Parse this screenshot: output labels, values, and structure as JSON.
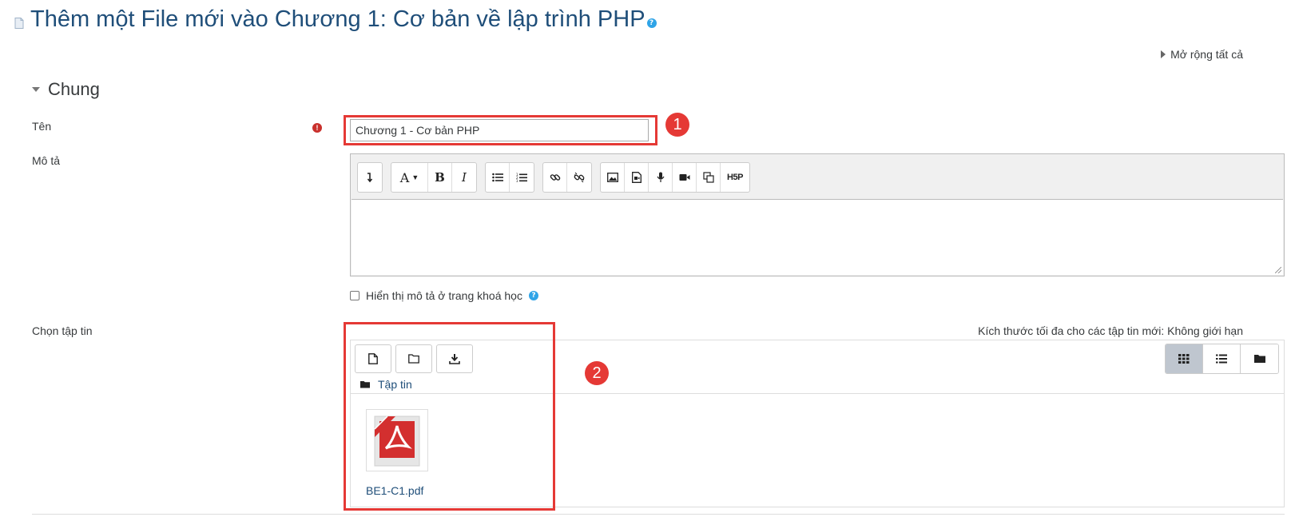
{
  "header": {
    "title": "Thêm một File mới vào Chương 1: Cơ bản về lập trình PHP",
    "expand_all": "Mở rộng tất cả"
  },
  "section": {
    "title": "Chung"
  },
  "form": {
    "name_label": "Tên",
    "name_value": "Chương 1 - Cơ bản PHP",
    "description_label": "Mô tả",
    "show_description_label": "Hiển thị mô tả ở trang khoá học",
    "choose_file_label": "Chọn tập tin",
    "max_size_text": "Kích thước tối đa cho các tập tin mới: Không giới hạn"
  },
  "editor": {
    "toolbar_icons": [
      "toggle-toolbar-icon",
      "font-style-icon",
      "bold-icon",
      "italic-icon",
      "unordered-list-icon",
      "ordered-list-icon",
      "link-icon",
      "unlink-icon",
      "image-icon",
      "media-icon",
      "record-audio-icon",
      "record-video-icon",
      "manage-files-icon",
      "h5p-icon"
    ],
    "h5p_label": "H5P"
  },
  "filepicker": {
    "breadcrumb": "Tập tin",
    "files": [
      {
        "name": "BE1-C1.pdf",
        "type": "pdf"
      }
    ],
    "view_modes": [
      "grid-view",
      "list-view",
      "tree-view"
    ],
    "active_view": "grid-view"
  },
  "annotations": {
    "badge1": "1",
    "badge2": "2",
    "highlight_color": "#e53935"
  },
  "colors": {
    "title": "#1f4e79",
    "help": "#2fa4e7",
    "required": "#c9302c"
  }
}
